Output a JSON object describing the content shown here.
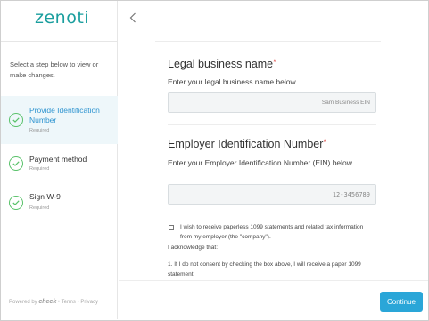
{
  "app": {
    "logo_text": "zenoti"
  },
  "sidebar": {
    "instructions": "Select a step below to view or make changes.",
    "steps": [
      {
        "label": "Provide Identification Number",
        "status": "Required",
        "active": true
      },
      {
        "label": "Payment method",
        "status": "Required",
        "active": false
      },
      {
        "label": "Sign W-9",
        "status": "Required",
        "active": false
      }
    ],
    "footer": {
      "powered_by": "Powered by",
      "brand": "check",
      "terms": "Terms",
      "separator": "•",
      "privacy": "Privacy"
    }
  },
  "main": {
    "back_icon": "chevron-left-icon",
    "legal_name": {
      "title": "Legal business name",
      "required_mark": "*",
      "description": "Enter your legal business name below.",
      "placeholder": "Sam Business EIN"
    },
    "ein": {
      "title": "Employer Identification Number",
      "required_mark": "*",
      "description": "Enter your Employer Identification Number (EIN) below.",
      "placeholder": "12-3456789"
    },
    "consent": {
      "checkbox_label": "I wish to receive paperless 1099 statements and related tax information from my employer (the \"company\").",
      "acknowledge": "I acknowledge that:",
      "item_1": "1. If I do not consent by checking the box above, I will receive a paper 1099 statement."
    },
    "continue_label": "Continue"
  },
  "colors": {
    "accent": "#2aa6d8",
    "brand": "#1a9e9e",
    "check": "#59c26a",
    "required": "#e0514d",
    "active_bg": "#eef7fa"
  }
}
